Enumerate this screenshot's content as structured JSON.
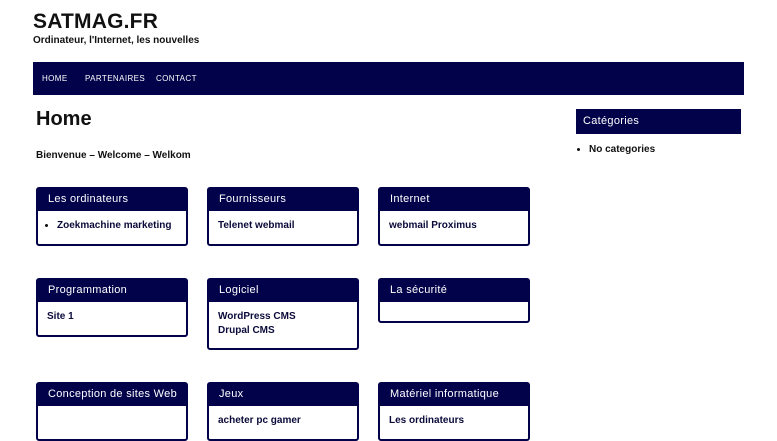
{
  "site": {
    "title": "SATMAG.FR",
    "tagline": "Ordinateur, l'Internet, les nouvelles"
  },
  "nav": {
    "items": [
      "HOME",
      "PARTENAIRES",
      "CONTACT"
    ]
  },
  "page": {
    "title": "Home",
    "intro": "Bienvenue – Welcome – Welkom"
  },
  "sidebar": {
    "heading": "Catégories",
    "items": [
      "No categories"
    ]
  },
  "widgets": [
    {
      "title": "Les ordinateurs",
      "links": [
        "Zoekmachine marketing"
      ]
    },
    {
      "title": "Fournisseurs",
      "links": [
        "Telenet webmail"
      ]
    },
    {
      "title": "Internet",
      "links": [
        "webmail Proximus"
      ]
    },
    {
      "title": "Programmation",
      "links": [
        "Site 1"
      ]
    },
    {
      "title": "Logiciel",
      "links": [
        "WordPress CMS",
        "Drupal CMS"
      ]
    },
    {
      "title": "La sécurité",
      "links": []
    },
    {
      "title": "Conception de sites Web",
      "links": []
    },
    {
      "title": "Jeux",
      "links": [
        "acheter pc gamer"
      ]
    },
    {
      "title": "Matériel informatique",
      "links": [
        "Les ordinateurs"
      ]
    }
  ],
  "colors": {
    "accent": "#02024a"
  }
}
